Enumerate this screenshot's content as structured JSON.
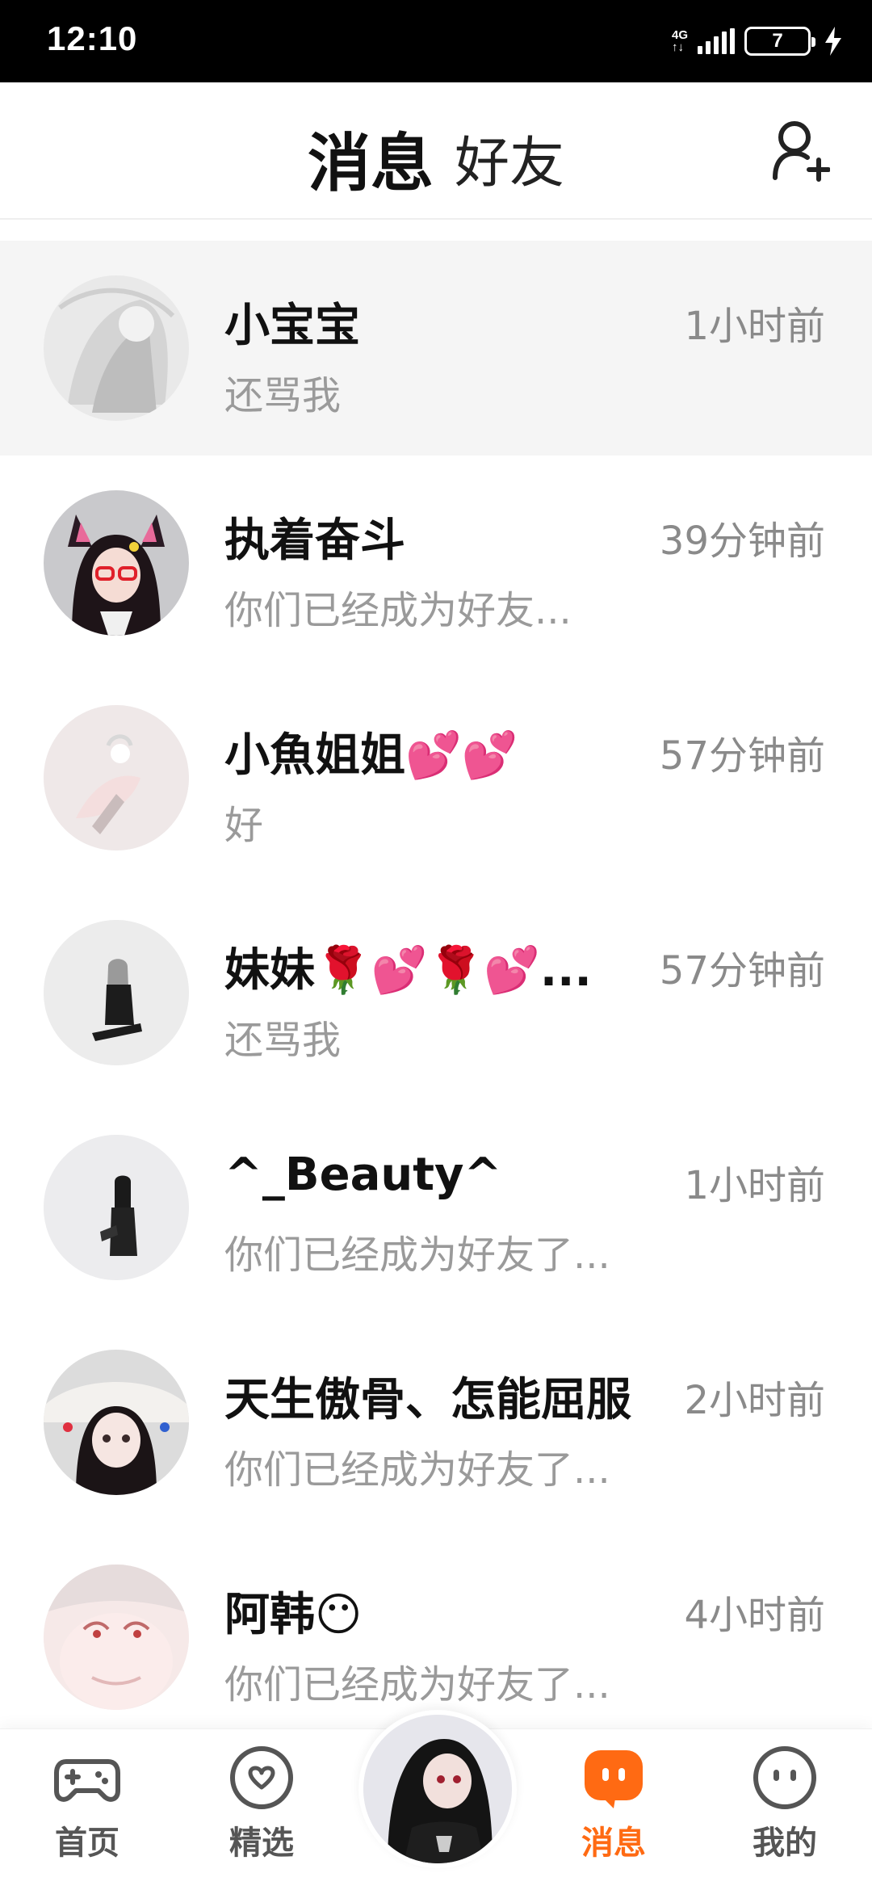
{
  "status_bar": {
    "time": "12:10",
    "network_top": "4G",
    "network_bottom": "↑↓",
    "battery": "7"
  },
  "header": {
    "tabs": [
      {
        "label": "消息",
        "active": true
      },
      {
        "label": "好友",
        "active": false
      }
    ],
    "add_friend_icon": "add-person-icon",
    "accent_color": "#ff7a1a"
  },
  "chats": [
    {
      "name": "小宝宝",
      "time": "1小时前",
      "preview": "还骂我"
    },
    {
      "name": "执着奋斗",
      "time": "39分钟前",
      "preview": "你们已经成为好友..."
    },
    {
      "name": "小魚姐姐💕💕",
      "time": "57分钟前",
      "preview": "好"
    },
    {
      "name": "妹妹🌹💕🌹💕...",
      "time": "57分钟前",
      "preview": "还骂我"
    },
    {
      "name": "^_Beauty^",
      "time": "1小时前",
      "preview": "你们已经成为好友了..."
    },
    {
      "name": "天生傲骨、怎能屈服",
      "time": "2小时前",
      "preview": "你们已经成为好友了..."
    },
    {
      "name": "阿韩😶",
      "time": "4小时前",
      "preview": "你们已经成为好友了..."
    }
  ],
  "bottom_nav": {
    "items": [
      {
        "label": "首页",
        "icon": "gamepad-icon",
        "active": false
      },
      {
        "label": "精选",
        "icon": "heart-badge-icon",
        "active": false
      },
      {
        "label": "消息",
        "icon": "message-icon",
        "active": true
      },
      {
        "label": "我的",
        "icon": "face-icon",
        "active": false
      }
    ],
    "active_color": "#ff6a13"
  }
}
